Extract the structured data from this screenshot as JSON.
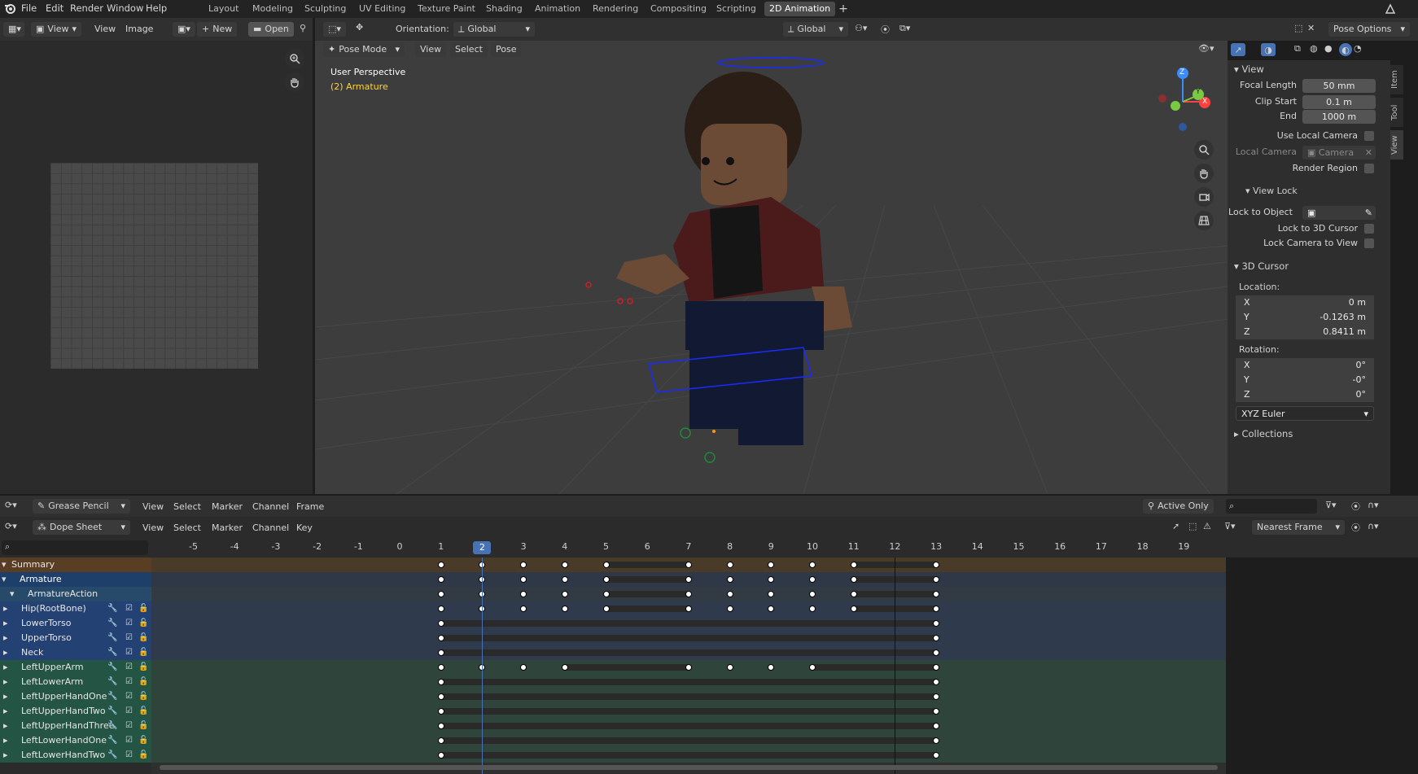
{
  "menubar": {
    "items": [
      "File",
      "Edit",
      "Render",
      "Window",
      "Help"
    ],
    "workspaces": [
      "Layout",
      "Modeling",
      "Sculpting",
      "UV Editing",
      "Texture Paint",
      "Shading",
      "Animation",
      "Rendering",
      "Compositing",
      "Scripting",
      "2D Animation"
    ],
    "active_workspace": "2D Animation"
  },
  "image_editor": {
    "view_label": "View",
    "menu_view": "View",
    "menu_image": "Image",
    "new_label": "New",
    "open_label": "Open"
  },
  "viewport_header": {
    "orientation_label": "Orientation:",
    "orientation_value": "Global",
    "transform_value": "Global",
    "pose_options": "Pose Options",
    "mode": "Pose Mode",
    "menus": [
      "View",
      "Select",
      "Pose"
    ]
  },
  "viewport": {
    "perspective": "User Perspective",
    "object": "(2) Armature",
    "gizmo": {
      "z": "Z",
      "y": "Y",
      "x": "X"
    }
  },
  "npanel": {
    "tabs": [
      "Item",
      "Tool",
      "View"
    ],
    "view_section": "View",
    "focal_length_label": "Focal Length",
    "focal_length": "50 mm",
    "clip_start_label": "Clip Start",
    "clip_start": "0.1 m",
    "end_label": "End",
    "end": "1000 m",
    "use_local_camera": "Use Local Camera",
    "local_camera_label": "Local Camera",
    "local_camera_value": "Camera",
    "render_region": "Render Region",
    "view_lock_section": "View Lock",
    "lock_to_object": "Lock to Object",
    "lock_to_3d_cursor": "Lock to 3D Cursor",
    "lock_camera_to_view": "Lock Camera to View",
    "cursor_section": "3D Cursor",
    "location_label": "Location:",
    "loc_x_label": "X",
    "loc_x": "0 m",
    "loc_y_label": "Y",
    "loc_y": "-0.1263 m",
    "loc_z_label": "Z",
    "loc_z": "0.8411 m",
    "rotation_label": "Rotation:",
    "rot_x_label": "X",
    "rot_x": "0°",
    "rot_y_label": "Y",
    "rot_y": "-0°",
    "rot_z_label": "Z",
    "rot_z": "0°",
    "rotation_mode": "XYZ Euler",
    "collections_section": "Collections"
  },
  "gp_header": {
    "mode": "Grease Pencil",
    "menus": [
      "View",
      "Select",
      "Marker",
      "Channel",
      "Frame"
    ],
    "active_only": "Active Only"
  },
  "ds_header": {
    "mode": "Dope Sheet",
    "menus": [
      "View",
      "Select",
      "Marker",
      "Channel",
      "Key"
    ],
    "snap": "Nearest Frame"
  },
  "timeline": {
    "ticks": [
      "-5",
      "-4",
      "-3",
      "-2",
      "-1",
      "0",
      "1",
      "2",
      "3",
      "4",
      "5",
      "6",
      "7",
      "8",
      "9",
      "10",
      "11",
      "12",
      "13",
      "14",
      "15",
      "16",
      "17",
      "18",
      "19"
    ],
    "current_frame": "2",
    "current_frame_value": 2,
    "end_frame_value": 12
  },
  "channels": [
    {
      "label": "Summary",
      "kind": "summary",
      "keys": [
        1,
        2,
        3,
        4,
        5,
        7,
        8,
        9,
        10,
        11,
        13
      ]
    },
    {
      "label": "Armature",
      "kind": "object",
      "keys": [
        1,
        2,
        3,
        4,
        5,
        7,
        8,
        9,
        10,
        11,
        13
      ]
    },
    {
      "label": "ArmatureAction",
      "kind": "action",
      "keys": [
        1,
        2,
        3,
        4,
        5,
        7,
        8,
        9,
        10,
        11,
        13
      ]
    },
    {
      "label": "Hip(RootBone)",
      "kind": "group-blue",
      "keys": [
        1,
        2,
        3,
        4,
        5,
        7,
        8,
        9,
        10,
        11,
        13
      ]
    },
    {
      "label": "LowerTorso",
      "kind": "group-blue",
      "keys": [
        1,
        13
      ]
    },
    {
      "label": "UpperTorso",
      "kind": "group-blue",
      "keys": [
        1,
        13
      ]
    },
    {
      "label": "Neck",
      "kind": "group-blue",
      "keys": [
        1,
        13
      ]
    },
    {
      "label": "LeftUpperArm",
      "kind": "group-green",
      "keys": [
        1,
        2,
        3,
        4,
        7,
        8,
        9,
        10,
        13
      ]
    },
    {
      "label": "LeftLowerArm",
      "kind": "group-green",
      "keys": [
        1,
        13
      ]
    },
    {
      "label": "LeftUpperHandOne",
      "kind": "group-green",
      "keys": [
        1,
        13
      ]
    },
    {
      "label": "LeftUpperHandTwo",
      "kind": "group-green",
      "keys": [
        1,
        13
      ]
    },
    {
      "label": "LeftUpperHandThree",
      "kind": "group-green",
      "keys": [
        1,
        13
      ]
    },
    {
      "label": "LeftLowerHandOne",
      "kind": "group-green",
      "keys": [
        1,
        13
      ]
    },
    {
      "label": "LeftLowerHandTwo",
      "kind": "group-green",
      "keys": [
        1,
        13
      ]
    }
  ]
}
